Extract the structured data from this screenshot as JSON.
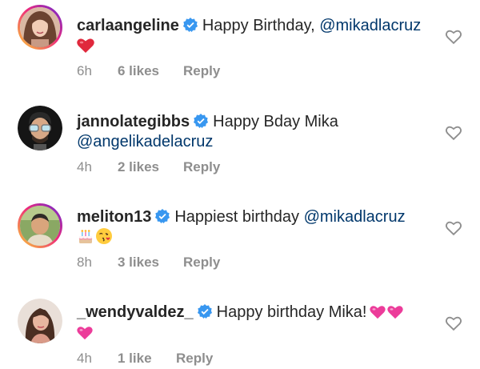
{
  "comments": [
    {
      "username": "carlaangeline",
      "text": "Happy Birthday, ",
      "mention": "@mikadlacruz",
      "line2_text": "",
      "line2_mention": "",
      "time": "6h",
      "likes": "6 likes",
      "reply": "Reply",
      "avatar_icon": "profile-photo",
      "line2_emoji": "red-heart-emoji"
    },
    {
      "username": "jannolategibbs",
      "text": "Happy Bday Mika",
      "mention": "",
      "line2_text": "",
      "line2_mention": "@angelikadelacruz",
      "time": "4h",
      "likes": "2 likes",
      "reply": "Reply",
      "avatar_icon": "cartoon-avatar-with-glasses"
    },
    {
      "username": "meliton13",
      "text": "Happiest birthday ",
      "mention": "@mikadlacruz",
      "line2_text": "",
      "line2_mention": "",
      "time": "8h",
      "likes": "3 likes",
      "reply": "Reply",
      "avatar_icon": "profile-photo",
      "line2_emoji": "birthday-cake-and-kiss-emoji"
    },
    {
      "username": "_wendyvaldez_",
      "text": "Happy birthday Mika!",
      "mention": "",
      "line2_text": "",
      "line2_mention": "",
      "time": "4h",
      "likes": "1 like",
      "reply": "Reply",
      "avatar_icon": "profile-photo",
      "trailing_emoji": "pink-hearts-emoji",
      "line2_emoji": "pink-heart-emoji"
    }
  ],
  "colors": {
    "text": "#262626",
    "mention": "#00376b",
    "meta": "#8e8e8e",
    "verified": "#3897f0",
    "story_ring_start": "#f9ce34",
    "story_ring_end": "#6228d7"
  },
  "icons": {
    "verified": "verified-badge-icon",
    "like": "heart-outline-icon"
  }
}
